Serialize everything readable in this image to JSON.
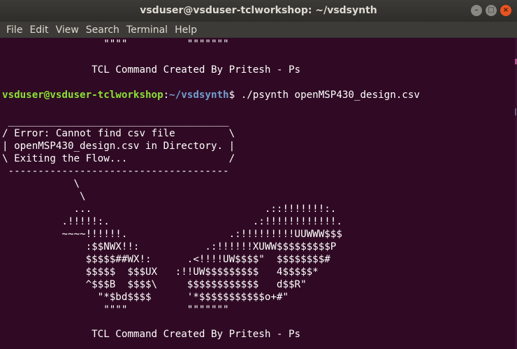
{
  "window": {
    "title": "vsduser@vsduser-tclworkshop: ~/vsdsynth",
    "controls": {
      "minimize": "–",
      "maximize": "□",
      "close": "×"
    }
  },
  "menu": [
    "File",
    "Edit",
    "View",
    "Search",
    "Terminal",
    "Help"
  ],
  "terminal": {
    "lines": [
      "                 \"\"\"\"          \"\"\"\"\"\"\"",
      "",
      "               TCL Command Created By Pritesh - Ps",
      "",
      "",
      "",
      " _____________________________________",
      "/ Error: Cannot find csv file         \\",
      "| openMSP430_design.csv in Directory. |",
      "\\ Exiting the Flow...                 /",
      " -------------------------------------",
      "            \\",
      "             \\",
      "            ...                             .::!!!!!!!:.",
      "          .!!!!!:.                        .:!!!!!!!!!!!!.",
      "          ~~~~!!!!!!.                 .:!!!!!!!!!UUWWW$$$",
      "              :$$NWX!!:           .:!!!!!!XUWW$$$$$$$$$P",
      "              $$$$$##WX!:      .<!!!!UW$$$$\"  $$$$$$$$#",
      "              $$$$$  $$$UX   :!!UW$$$$$$$$$   4$$$$$*",
      "              ^$$$B  $$$$\\     $$$$$$$$$$$$   d$$R\"",
      "                \"*$bd$$$$      '*$$$$$$$$$$$o+#\"",
      "                 \"\"\"\"          \"\"\"\"\"\"\"",
      "",
      "               TCL Command Created By Pritesh - Ps"
    ],
    "prompt": {
      "user_host": "vsduser@vsduser-tclworkshop",
      "separator": ":",
      "path": "~/vsdsynth",
      "symbol": "$ ",
      "command": "./psynth openMSP430_design.csv"
    }
  }
}
